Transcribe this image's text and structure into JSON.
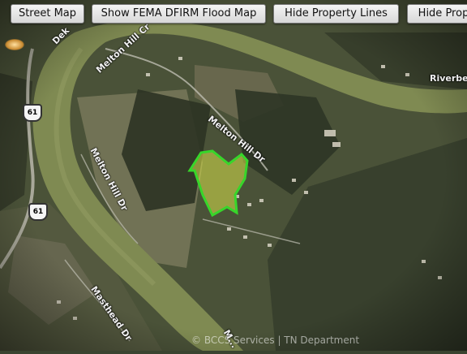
{
  "toolbar": {
    "street_map_label": "Street Map",
    "fema_label": "Show FEMA DFIRM Flood Map",
    "property_lines_label": "Hide Property Lines",
    "property_label": "Hide Prop"
  },
  "map": {
    "road_labels": {
      "melton_hill_cir": "Melton Hill Cr",
      "melton_hill_dr_upper": "Melton Hill Dr",
      "melton_hill_dr_left": "Melton Hill Dr",
      "masthead_dr": "Masthead Dr",
      "riverbend": "Riverbe",
      "dek": "Dek",
      "bottom_partial": "M..."
    },
    "highway_shields": [
      "61",
      "61"
    ],
    "parcel_highlight_color": "#37d62a",
    "river_color": "#7f8a52",
    "footer_credit": "© BCCS Services | TN Department"
  }
}
